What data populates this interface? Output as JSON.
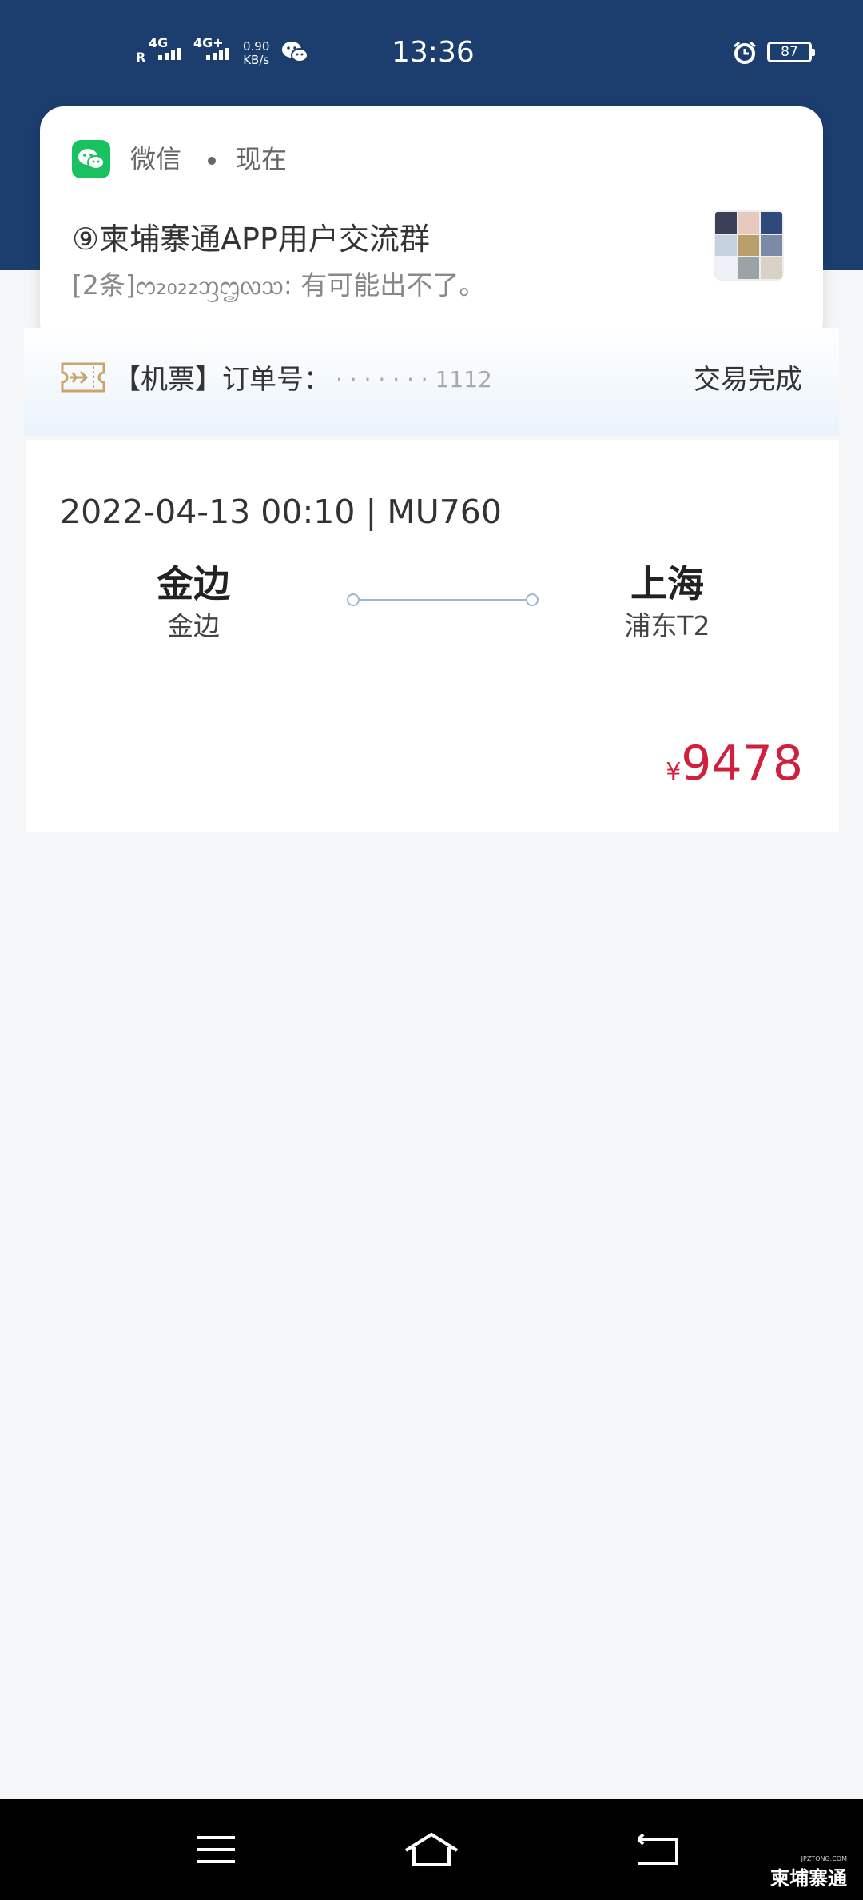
{
  "status_bar": {
    "sig1_top": "4G",
    "sig1_left": "R",
    "sig2_top": "4G+",
    "net_speed_value": "0.90",
    "net_speed_unit": "KB/s",
    "time": "13:36",
    "battery": "87",
    "icons": [
      "wechat-status-icon",
      "alarm-icon",
      "battery-icon"
    ]
  },
  "notification": {
    "app_name": "微信",
    "time": "现在",
    "title": "⑨柬埔寨通APP用户交流群",
    "message": "[2条]ᦂ₂₀₂₂ᦀᦗᦟᦉ: 有可能出不了。",
    "icon": "wechat-icon",
    "accent": "#19c160"
  },
  "order": {
    "label": "【机票】订单号：",
    "order_no": "· · · · · · · 1112",
    "status": "交易完成",
    "icon": "plane-ticket-icon"
  },
  "flight": {
    "datetime_flight": "2022-04-13 00:10 | MU760",
    "departure_city": "金边",
    "departure_airport": "金边",
    "arrival_city": "上海",
    "arrival_airport": "浦东T2",
    "currency": "¥",
    "price": "9478",
    "price_color": "#d0203b"
  },
  "nav_bar": {
    "buttons": [
      "menu-icon",
      "home-icon",
      "back-icon"
    ],
    "watermark": "柬埔寨通",
    "watermark_small": "JPZTONG.COM"
  },
  "colors": {
    "header": "#1c3e6e",
    "background": "#f4f6f7"
  }
}
